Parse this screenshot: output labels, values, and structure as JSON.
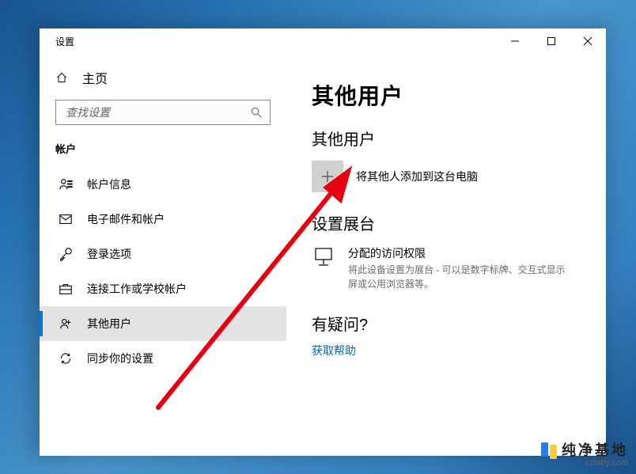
{
  "window": {
    "title": "设置"
  },
  "sidebar": {
    "home_label": "主页",
    "search_placeholder": "查找设置",
    "section": "帐户",
    "items": [
      {
        "label": "帐户信息",
        "icon": "account-info",
        "active": false
      },
      {
        "label": "电子邮件和帐户",
        "icon": "email",
        "active": false
      },
      {
        "label": "登录选项",
        "icon": "signin",
        "active": false
      },
      {
        "label": "连接工作或学校帐户",
        "icon": "work",
        "active": false
      },
      {
        "label": "其他用户",
        "icon": "other-users",
        "active": true
      },
      {
        "label": "同步你的设置",
        "icon": "sync",
        "active": false
      }
    ]
  },
  "main": {
    "title": "其他用户",
    "sub_other": "其他用户",
    "add_user_label": "将其他人添加到这台电脑",
    "kiosk_heading": "设置展台",
    "kiosk": {
      "title": "分配的访问权限",
      "desc": "将此设备设置为展台 - 可以是数字标牌、交互式显示屏或公用浏览器等。"
    },
    "help_heading": "有疑问?",
    "help_link": "获取帮助"
  },
  "branding": {
    "name": "纯净基地",
    "url": "czlaby.com"
  }
}
